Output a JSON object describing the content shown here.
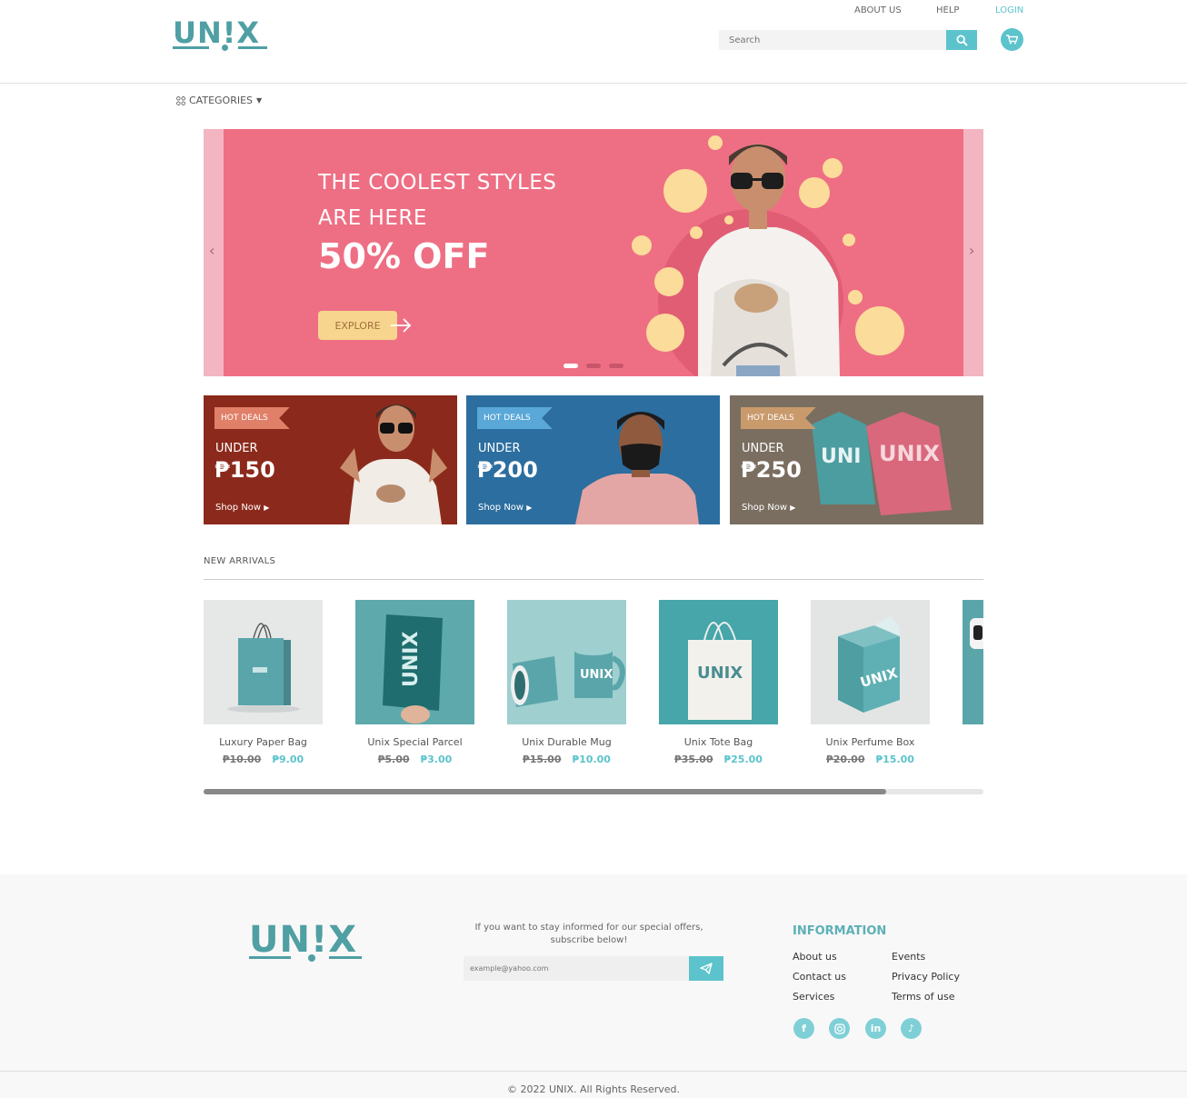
{
  "header": {
    "brand": "UN!X",
    "nav": {
      "about": "ABOUT US",
      "help": "HELP",
      "login": "LOGIN"
    },
    "search": {
      "placeholder": "Search"
    },
    "accent": "#5cc3cc",
    "brand_color": "#4f9fa3",
    "icons": {
      "search": "search-icon",
      "cart": "cart-icon"
    }
  },
  "categories": {
    "label": "CATEGORIES",
    "icon": "grid-icon"
  },
  "hero": {
    "line1": "THE COOLEST STYLES",
    "line2": "ARE HERE",
    "line3": "50% OFF",
    "cta": "EXPLORE",
    "slide_count": 3,
    "active_slide": 1,
    "bg_color": "#ee6f84"
  },
  "deals": [
    {
      "tag": "HOT DEALS",
      "under": "UNDER",
      "price": "₱150",
      "shop": "Shop Now",
      "bg": "#8b2a1c",
      "tag_bg": "#e08069"
    },
    {
      "tag": "HOT DEALS",
      "under": "UNDER",
      "price": "₱200",
      "shop": "Shop Now",
      "bg": "#2c6e9f",
      "tag_bg": "#5aa8d8"
    },
    {
      "tag": "HOT DEALS",
      "under": "UNDER",
      "price": "₱250",
      "shop": "Shop Now",
      "bg": "#7a6e60",
      "tag_bg": "#c99a6c"
    }
  ],
  "arrivals": {
    "title": "NEW ARRIVALS",
    "products": [
      {
        "name": "Luxury Paper Bag",
        "old": "₱10.00",
        "new": "₱9.00"
      },
      {
        "name": "Unix Special Parcel",
        "old": "₱5.00",
        "new": "₱3.00"
      },
      {
        "name": "Unix Durable Mug",
        "old": "₱15.00",
        "new": "₱10.00"
      },
      {
        "name": "Unix Tote Bag",
        "old": "₱35.00",
        "new": "₱25.00"
      },
      {
        "name": "Unix Perfume Box",
        "old": "₱20.00",
        "new": "₱15.00"
      }
    ],
    "scroll_fraction": 0.875
  },
  "footer": {
    "brand": "UN!X",
    "subscribe_text": "If you want to stay informed for our special offers, subscribe below!",
    "email_placeholder": "example@yahoo.com",
    "info_title": "INFORMATION",
    "links_col1": [
      "About us",
      "Contact us",
      "Services"
    ],
    "links_col2": [
      "Events",
      "Privacy Policy",
      "Terms of use"
    ],
    "socials": [
      "facebook-icon",
      "instagram-icon",
      "linkedin-icon",
      "tiktok-icon"
    ],
    "copyright": "© 2022 UNIX. All Rights Reserved."
  }
}
